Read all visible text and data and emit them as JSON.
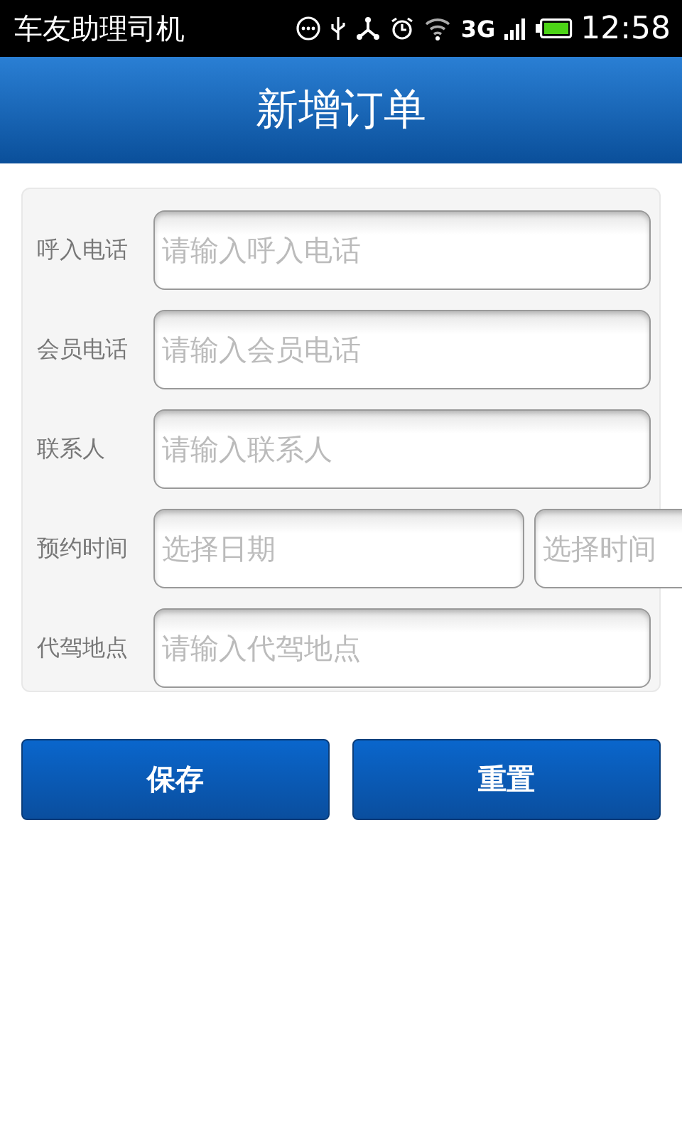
{
  "status_bar": {
    "app_name": "车友助理司机",
    "network": "3G",
    "time": "12:58"
  },
  "header": {
    "title": "新增订单"
  },
  "form": {
    "rows": [
      {
        "label": "呼入电话",
        "fields": [
          {
            "placeholder": "请输入呼入电话"
          }
        ]
      },
      {
        "label": "会员电话",
        "fields": [
          {
            "placeholder": "请输入会员电话"
          }
        ]
      },
      {
        "label": "联系人",
        "fields": [
          {
            "placeholder": "请输入联系人"
          }
        ]
      },
      {
        "label": "预约时间",
        "fields": [
          {
            "placeholder": "选择日期"
          },
          {
            "placeholder": "选择时间"
          }
        ]
      },
      {
        "label": "代驾地点",
        "fields": [
          {
            "placeholder": "请输入代驾地点"
          }
        ]
      }
    ]
  },
  "buttons": [
    "保存",
    "重置"
  ]
}
